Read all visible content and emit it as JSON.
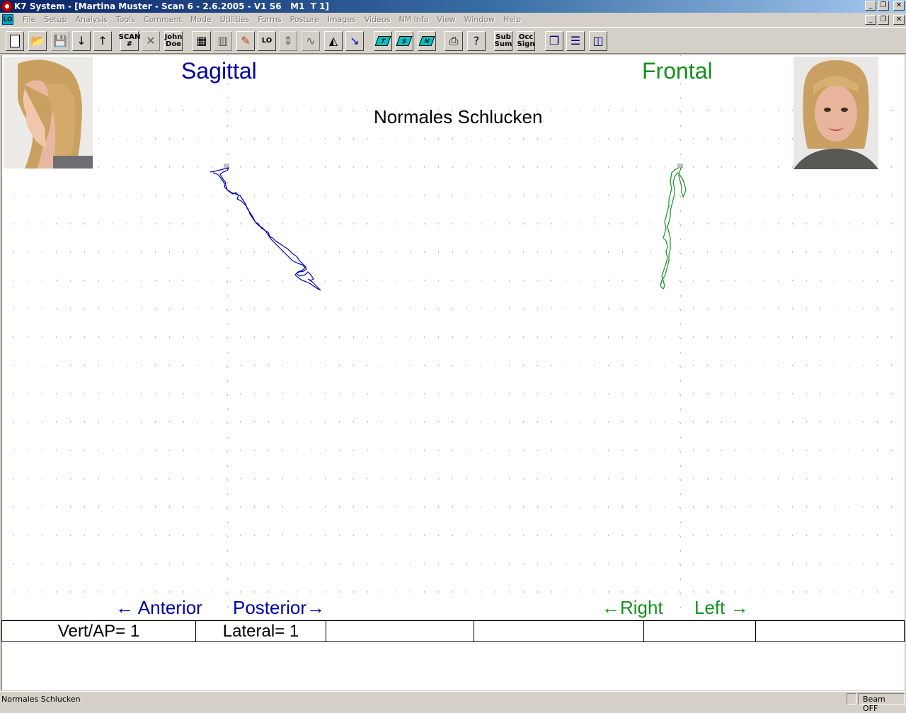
{
  "window": {
    "title": "K7 System - [Martina Muster - Scan 6 - 2.6.2005 - V1 S6   M1  T 1]",
    "controls": {
      "minimize": "_",
      "restore": "❐",
      "close": "✕"
    }
  },
  "menubar": {
    "mdi_icon": "LO",
    "items": [
      "File",
      "Setup",
      "Analysis",
      "Tools",
      "Comment",
      "Mode",
      "Utilities",
      "Forms",
      "Posture",
      "Images",
      "Videos",
      "NM Info",
      "View",
      "Window",
      "Help"
    ]
  },
  "toolbar": {
    "scan_label": "SCAN #",
    "scan_top": "SCAN",
    "scan_bottom": "#",
    "john_top": "John",
    "john_bottom": "Doe",
    "t_label": "T",
    "s_label": "S",
    "n_label": "N",
    "sub_top": "Sub",
    "sub_bottom": "Sum",
    "occ_top": "Occ",
    "occ_bottom": "Sign",
    "lo_label": "LO"
  },
  "plot": {
    "title": "Normales Schlucken",
    "sagittal_label": "Sagittal",
    "frontal_label": "Frontal",
    "sagittal_color": "#0000a8",
    "frontal_color": "#14901e",
    "sagittal_left_dir": "← Anterior",
    "sagittal_right_dir": "Posterior→",
    "frontal_left_dir": "←Right",
    "frontal_right_dir": "Left →"
  },
  "footer": {
    "cells": [
      "Vert/AP= 1",
      "Lateral= 1",
      "",
      "",
      "",
      ""
    ]
  },
  "statusbar": {
    "text": "Normales Schlucken",
    "beam": "Beam OFF"
  }
}
